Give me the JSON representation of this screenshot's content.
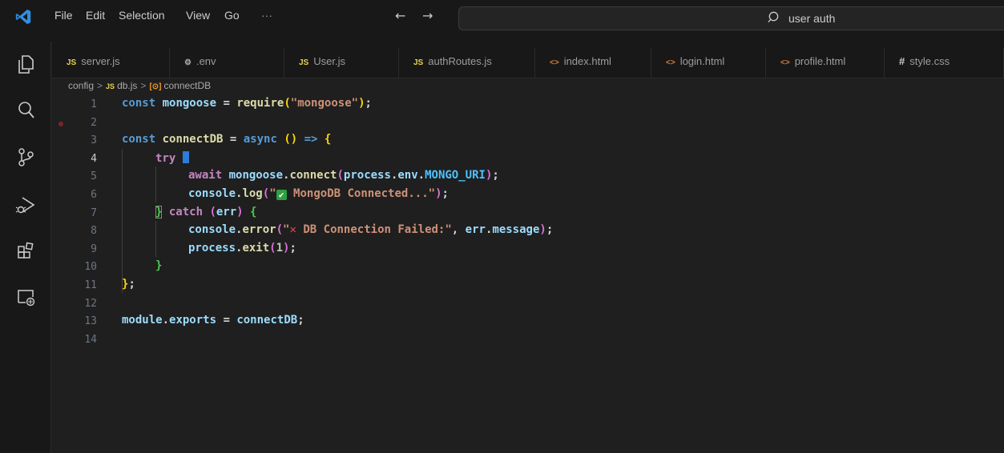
{
  "titlebar": {
    "menu": [
      "File",
      "Edit",
      "Selection",
      "View",
      "Go",
      "···"
    ],
    "nav_back": "←",
    "nav_forward": "→",
    "search_text": "user auth"
  },
  "activitybar": {
    "items": [
      "explorer-icon",
      "search-icon",
      "source-control-icon",
      "run-debug-icon",
      "extensions-icon",
      "remote-explorer-icon"
    ]
  },
  "tabs": [
    {
      "icon": "JS",
      "label": "server.js"
    },
    {
      "icon": "⚙",
      "label": ".env"
    },
    {
      "icon": "JS",
      "label": "User.js"
    },
    {
      "icon": "JS",
      "label": "authRoutes.js"
    },
    {
      "icon": "<>",
      "label": "index.html"
    },
    {
      "icon": "<>",
      "label": "login.html"
    },
    {
      "icon": "<>",
      "label": "profile.html"
    },
    {
      "icon": "#",
      "label": "style.css"
    }
  ],
  "breadcrumb": {
    "folder": "config",
    "file_icon": "JS",
    "file": "db.js",
    "symbol_icon": "[⊙]",
    "symbol": "connectDB",
    "separator": ">"
  },
  "editor": {
    "line_numbers": [
      "1",
      "2",
      "3",
      "4",
      "5",
      "6",
      "7",
      "8",
      "9",
      "10",
      "11",
      "12",
      "13",
      "14"
    ],
    "active_line": "4",
    "lines": {
      "l1": {
        "kw": "const",
        "var": " mongoose ",
        "eq": "= ",
        "fn": "require",
        "open": "(",
        "str": "\"mongoose\"",
        "close": ")",
        "semi": ";"
      },
      "l3": {
        "kw": "const",
        "fn": " connectDB ",
        "eq": "= ",
        "async": "async",
        "parens": " () ",
        "arrow": "=> ",
        "brace": "{"
      },
      "l4": {
        "try": "try ",
        "brace": ""
      },
      "l5": {
        "await": "await",
        "var": " mongoose",
        "dot": ".",
        "fn": "connect",
        "open": "(",
        "var2": "process",
        "dot2": ".",
        "var3": "env",
        "dot3": ".",
        "cst": "MONGO_URI",
        "close": ")",
        "semi": ";"
      },
      "l6": {
        "var": "console",
        "dot": ".",
        "fn": "log",
        "open": "(",
        "str1": "\"",
        "check": "✔",
        "str2": " MongoDB Connected...\"",
        "close": ")",
        "semi": ";"
      },
      "l7": {
        "brace": "}",
        "catch": " catch",
        "open": " (",
        "var": "err",
        "close": ")",
        "brace2": " {"
      },
      "l8": {
        "var": "console",
        "dot": ".",
        "fn": "error",
        "open": "(",
        "str1": "\"",
        "cross": "✕",
        "str2": " DB Connection Failed:\"",
        "comma": ", ",
        "var2": "err",
        "dot2": ".",
        "var3": "message",
        "close": ")",
        "semi": ";"
      },
      "l9": {
        "var": "process",
        "dot": ".",
        "fn": "exit",
        "open": "(",
        "num": "1",
        "close": ")",
        "semi": ";"
      },
      "l10": {
        "brace": "}"
      },
      "l11": {
        "brace": "}",
        "semi": ";"
      },
      "l13": {
        "var": "module",
        "dot": ".",
        "var2": "exports",
        "eq": " = ",
        "var3": "connectDB",
        "semi": ";"
      }
    }
  },
  "colors": {
    "background": "#1f1f1f",
    "chrome": "#181818",
    "keyword": "#569cd6",
    "control": "#c586c0",
    "variable": "#9cdcfe",
    "function": "#dcdcaa",
    "string": "#ce9178",
    "constant": "#4fc1ff"
  }
}
